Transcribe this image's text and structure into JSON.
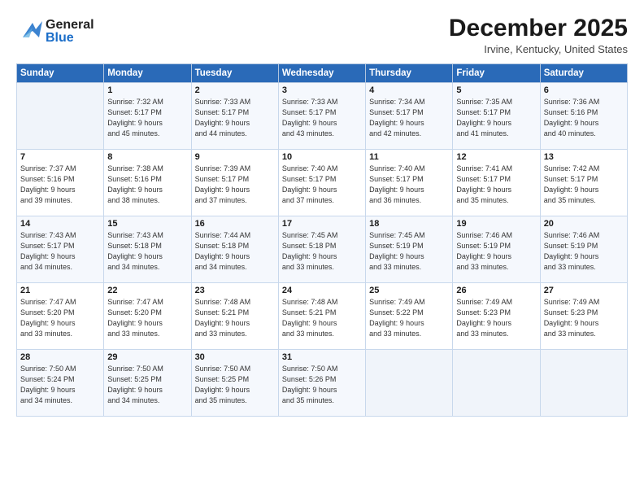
{
  "header": {
    "logo_general": "General",
    "logo_blue": "Blue",
    "month_title": "December 2025",
    "location": "Irvine, Kentucky, United States"
  },
  "weekdays": [
    "Sunday",
    "Monday",
    "Tuesday",
    "Wednesday",
    "Thursday",
    "Friday",
    "Saturday"
  ],
  "weeks": [
    [
      {
        "day": "",
        "info": ""
      },
      {
        "day": "1",
        "info": "Sunrise: 7:32 AM\nSunset: 5:17 PM\nDaylight: 9 hours\nand 45 minutes."
      },
      {
        "day": "2",
        "info": "Sunrise: 7:33 AM\nSunset: 5:17 PM\nDaylight: 9 hours\nand 44 minutes."
      },
      {
        "day": "3",
        "info": "Sunrise: 7:33 AM\nSunset: 5:17 PM\nDaylight: 9 hours\nand 43 minutes."
      },
      {
        "day": "4",
        "info": "Sunrise: 7:34 AM\nSunset: 5:17 PM\nDaylight: 9 hours\nand 42 minutes."
      },
      {
        "day": "5",
        "info": "Sunrise: 7:35 AM\nSunset: 5:17 PM\nDaylight: 9 hours\nand 41 minutes."
      },
      {
        "day": "6",
        "info": "Sunrise: 7:36 AM\nSunset: 5:16 PM\nDaylight: 9 hours\nand 40 minutes."
      }
    ],
    [
      {
        "day": "7",
        "info": "Sunrise: 7:37 AM\nSunset: 5:16 PM\nDaylight: 9 hours\nand 39 minutes."
      },
      {
        "day": "8",
        "info": "Sunrise: 7:38 AM\nSunset: 5:16 PM\nDaylight: 9 hours\nand 38 minutes."
      },
      {
        "day": "9",
        "info": "Sunrise: 7:39 AM\nSunset: 5:17 PM\nDaylight: 9 hours\nand 37 minutes."
      },
      {
        "day": "10",
        "info": "Sunrise: 7:40 AM\nSunset: 5:17 PM\nDaylight: 9 hours\nand 37 minutes."
      },
      {
        "day": "11",
        "info": "Sunrise: 7:40 AM\nSunset: 5:17 PM\nDaylight: 9 hours\nand 36 minutes."
      },
      {
        "day": "12",
        "info": "Sunrise: 7:41 AM\nSunset: 5:17 PM\nDaylight: 9 hours\nand 35 minutes."
      },
      {
        "day": "13",
        "info": "Sunrise: 7:42 AM\nSunset: 5:17 PM\nDaylight: 9 hours\nand 35 minutes."
      }
    ],
    [
      {
        "day": "14",
        "info": "Sunrise: 7:43 AM\nSunset: 5:17 PM\nDaylight: 9 hours\nand 34 minutes."
      },
      {
        "day": "15",
        "info": "Sunrise: 7:43 AM\nSunset: 5:18 PM\nDaylight: 9 hours\nand 34 minutes."
      },
      {
        "day": "16",
        "info": "Sunrise: 7:44 AM\nSunset: 5:18 PM\nDaylight: 9 hours\nand 34 minutes."
      },
      {
        "day": "17",
        "info": "Sunrise: 7:45 AM\nSunset: 5:18 PM\nDaylight: 9 hours\nand 33 minutes."
      },
      {
        "day": "18",
        "info": "Sunrise: 7:45 AM\nSunset: 5:19 PM\nDaylight: 9 hours\nand 33 minutes."
      },
      {
        "day": "19",
        "info": "Sunrise: 7:46 AM\nSunset: 5:19 PM\nDaylight: 9 hours\nand 33 minutes."
      },
      {
        "day": "20",
        "info": "Sunrise: 7:46 AM\nSunset: 5:19 PM\nDaylight: 9 hours\nand 33 minutes."
      }
    ],
    [
      {
        "day": "21",
        "info": "Sunrise: 7:47 AM\nSunset: 5:20 PM\nDaylight: 9 hours\nand 33 minutes."
      },
      {
        "day": "22",
        "info": "Sunrise: 7:47 AM\nSunset: 5:20 PM\nDaylight: 9 hours\nand 33 minutes."
      },
      {
        "day": "23",
        "info": "Sunrise: 7:48 AM\nSunset: 5:21 PM\nDaylight: 9 hours\nand 33 minutes."
      },
      {
        "day": "24",
        "info": "Sunrise: 7:48 AM\nSunset: 5:21 PM\nDaylight: 9 hours\nand 33 minutes."
      },
      {
        "day": "25",
        "info": "Sunrise: 7:49 AM\nSunset: 5:22 PM\nDaylight: 9 hours\nand 33 minutes."
      },
      {
        "day": "26",
        "info": "Sunrise: 7:49 AM\nSunset: 5:23 PM\nDaylight: 9 hours\nand 33 minutes."
      },
      {
        "day": "27",
        "info": "Sunrise: 7:49 AM\nSunset: 5:23 PM\nDaylight: 9 hours\nand 33 minutes."
      }
    ],
    [
      {
        "day": "28",
        "info": "Sunrise: 7:50 AM\nSunset: 5:24 PM\nDaylight: 9 hours\nand 34 minutes."
      },
      {
        "day": "29",
        "info": "Sunrise: 7:50 AM\nSunset: 5:25 PM\nDaylight: 9 hours\nand 34 minutes."
      },
      {
        "day": "30",
        "info": "Sunrise: 7:50 AM\nSunset: 5:25 PM\nDaylight: 9 hours\nand 35 minutes."
      },
      {
        "day": "31",
        "info": "Sunrise: 7:50 AM\nSunset: 5:26 PM\nDaylight: 9 hours\nand 35 minutes."
      },
      {
        "day": "",
        "info": ""
      },
      {
        "day": "",
        "info": ""
      },
      {
        "day": "",
        "info": ""
      }
    ]
  ]
}
